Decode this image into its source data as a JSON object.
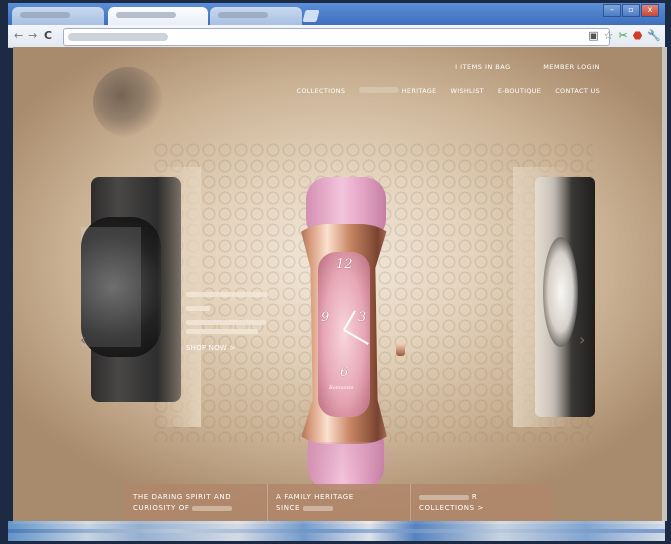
{
  "browser": {
    "tabs": [
      {
        "label": "",
        "active": false
      },
      {
        "label": "",
        "active": true
      },
      {
        "label": "",
        "active": false
      }
    ],
    "window_buttons": [
      "–",
      "▫",
      "x"
    ],
    "nav": {
      "back": "←",
      "forward": "→",
      "reload": "C"
    },
    "address": {
      "value": ""
    },
    "toolbar_icons": [
      "page-icon",
      "star-icon",
      "extension-icon",
      "adblock-icon",
      "wrench-icon"
    ]
  },
  "site": {
    "utility_links": [
      "I ITEMS IN BAG",
      "MEMBER LOGIN"
    ],
    "nav_items": [
      "COLLECTIONS",
      "HERITAGE",
      "WISHLIST",
      "E-BOUTIQUE",
      "CONTACT US"
    ],
    "hero": {
      "promo_cta": "SHOP NOW >",
      "prev_arrow": "‹",
      "next_arrow": "›",
      "dial_numerals": [
        "12",
        "9",
        "3",
        "6"
      ],
      "dial_brand": "Bonnante"
    },
    "panels": [
      {
        "line1": "THE DARING SPIRIT AND",
        "line2": "CURIOSITY OF"
      },
      {
        "line1": "A FAMILY HERITAGE",
        "line2": "SINCE"
      },
      {
        "line1": "R",
        "line2": "COLLECTIONS >"
      }
    ]
  },
  "colors": {
    "page_bg_center": "#f2e8da",
    "page_bg_edge": "#a88a6c",
    "strap_pink": "#e4a5c6",
    "case_rose_gold": "#d89b7c",
    "panel_bg": "#b0866a"
  }
}
